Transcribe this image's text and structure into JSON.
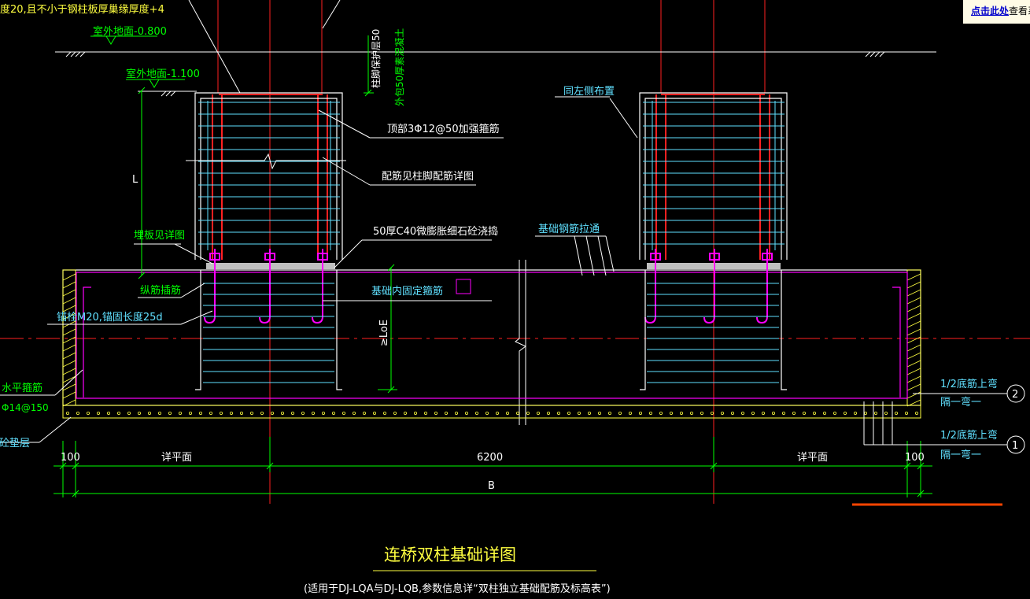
{
  "colors": {
    "background": "#000000",
    "white": "#ffffff",
    "red": "#ff2020",
    "green": "#00ff00",
    "cyan": "#60e0ff",
    "magenta": "#ff00ff",
    "yellow": "#ffff40",
    "orange": "#ff4500",
    "blue": "#2040ff"
  },
  "hint": {
    "link_text": "点击此处",
    "rest_text": "查看系"
  },
  "labels": {
    "top_note": "度20,且不小于钢柱板厚巢缘厚度+4",
    "grade_outdoor_0800": "室外地面-0.800",
    "grade_outdoor_1100": "室外地面-1.100",
    "dim_l": "L",
    "vertical_note_1": "柱脚保护层50",
    "vertical_note_2": "外包50厚素混凝土",
    "top_rebar_note": "顶部3Φ12@50加强箍筋",
    "column_rebar_note": "配筋见柱脚配筋详图",
    "grout_note": "50厚C40微膨胀细石砼浇捣",
    "same_as_left": "同左侧布置",
    "foundation_rebar_through": "基础钢筋拉通",
    "embed_plate_note": "埋板见详图",
    "long_rebar_note": "纵筋插筋",
    "fixing_stirrup_note": "基础内固定箍筋",
    "anchor_bolt_note": "锚栓M20,锚固长度25d",
    "anchorage_loe": "≥LoE",
    "horizontal_rebar_note": "水平箍筋",
    "horizontal_rebar_spec": "Φ14@150",
    "cushion_note": "素砼垫层",
    "bottom_rebar_2a": "1/2底筋上弯",
    "bottom_rebar_2b": "隔一弯一",
    "bottom_rebar_1a": "1/2底筋上弯",
    "bottom_rebar_1b": "隔一弯一",
    "callout_2": "2",
    "callout_1": "1"
  },
  "dimensions": {
    "left_edge": "100",
    "left_detail": "详平面",
    "middle": "6200",
    "right_detail": "详平面",
    "right_edge": "100",
    "overall": "B"
  },
  "title": {
    "main": "连桥双柱基础详图",
    "sub": "(适用于DJ-LQA与DJ-LQB,参数信息详“双柱独立基础配筋及标高表”)"
  }
}
